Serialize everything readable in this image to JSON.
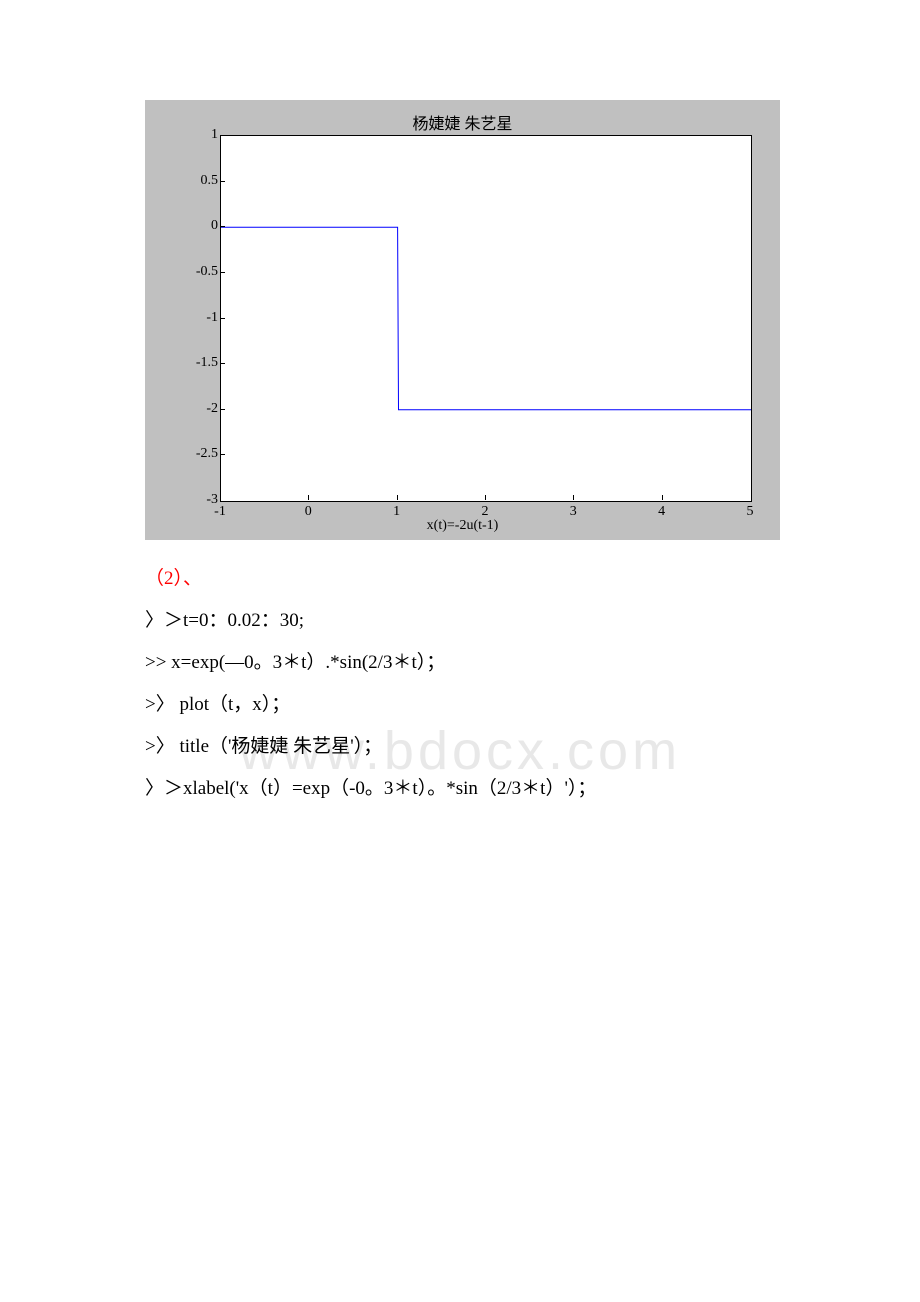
{
  "watermark": "www.bdocx.com",
  "chart_data": {
    "type": "line",
    "title": "杨婕婕 朱艺星",
    "xlabel": "x(t)=-2u(t-1)",
    "ylabel": "",
    "xlim": [
      -1,
      5
    ],
    "ylim": [
      -3,
      1
    ],
    "x_ticks": [
      -1,
      0,
      1,
      2,
      3,
      4,
      5
    ],
    "y_ticks": [
      -3,
      -2.5,
      -2,
      -1.5,
      -1,
      -0.5,
      0,
      0.5,
      1
    ],
    "series": [
      {
        "name": "x(t)",
        "x": [
          -1,
          1,
          1,
          5
        ],
        "y": [
          0,
          0,
          -2,
          -2
        ]
      }
    ]
  },
  "body": {
    "item_label": "（2）、",
    "lines": [
      "〉＞t=0：0.02：30;",
      ">> x=exp(—0。3＊t）.*sin(2/3＊t）；",
      ">〉 plot（t，x）；",
      ">〉 title（'杨婕婕 朱艺星'）；",
      "〉＞xlabel('x（t）=exp（-0。3＊t）。*sin（2/3＊t）'）；"
    ]
  }
}
